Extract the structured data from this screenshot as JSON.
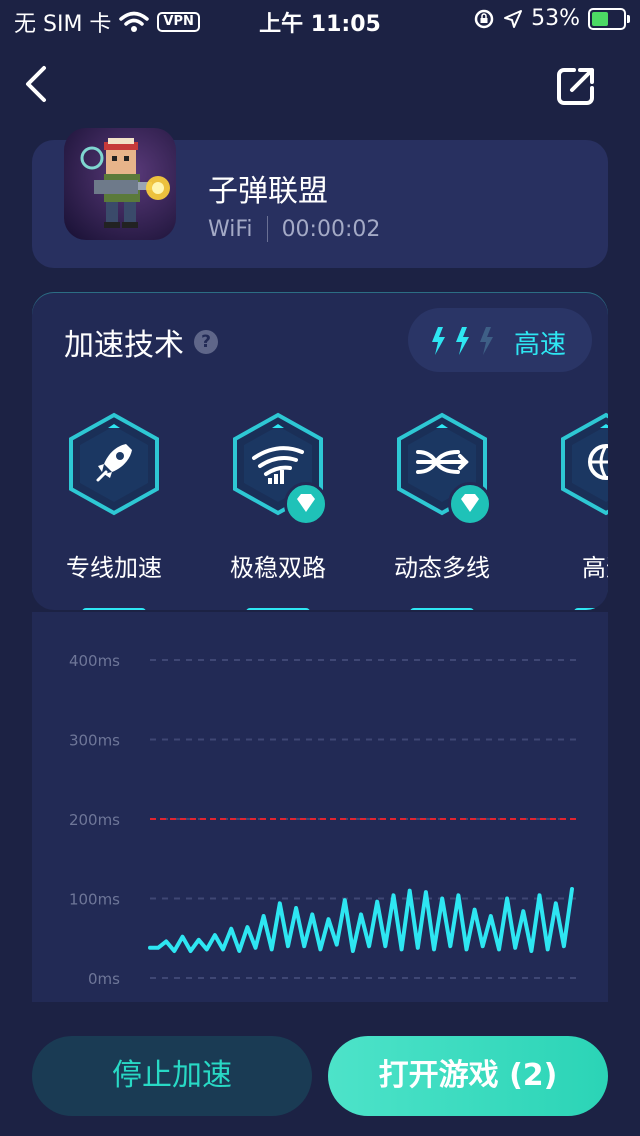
{
  "status_bar": {
    "carrier": "无 SIM 卡",
    "vpn": "VPN",
    "time": "上午 11:05",
    "battery_text": "53%",
    "battery_level": 0.53
  },
  "game": {
    "name": "子弹联盟",
    "network": "WiFi",
    "duration": "00:00:02"
  },
  "tech": {
    "title": "加速技术",
    "help": "?",
    "speed_label": "高速",
    "speed_level": 2,
    "features": [
      {
        "label": "专线加速",
        "icon": "rocket-icon",
        "premium": false
      },
      {
        "label": "极稳双路",
        "icon": "wifi-signal-icon",
        "premium": true
      },
      {
        "label": "动态多线",
        "icon": "multi-line-icon",
        "premium": true
      },
      {
        "label": "高速",
        "icon": "globe-icon",
        "premium": false
      }
    ]
  },
  "chart_data": {
    "type": "line",
    "y_ticks": [
      "400ms",
      "300ms",
      "200ms",
      "100ms",
      "0ms"
    ],
    "ylim": [
      0,
      400
    ],
    "threshold": 200,
    "threshold_color": "#e0242f",
    "series": [
      {
        "color": "#2ee6f2",
        "values": [
          38,
          38,
          46,
          34,
          52,
          34,
          48,
          36,
          54,
          36,
          62,
          34,
          64,
          38,
          78,
          36,
          94,
          40,
          88,
          40,
          80,
          36,
          74,
          42,
          98,
          34,
          80,
          40,
          96,
          40,
          104,
          36,
          110,
          38,
          108,
          36,
          100,
          40,
          104,
          36,
          86,
          40,
          78,
          36,
          100,
          38,
          84,
          34,
          104,
          36,
          94,
          40,
          112
        ]
      }
    ]
  },
  "buttons": {
    "stop": "停止加速",
    "open": "打开游戏 (2)"
  },
  "colors": {
    "background": "#1c2244",
    "card": "#283060",
    "accent": "#2ee6f2",
    "primary_button": "#3ddcc0"
  }
}
